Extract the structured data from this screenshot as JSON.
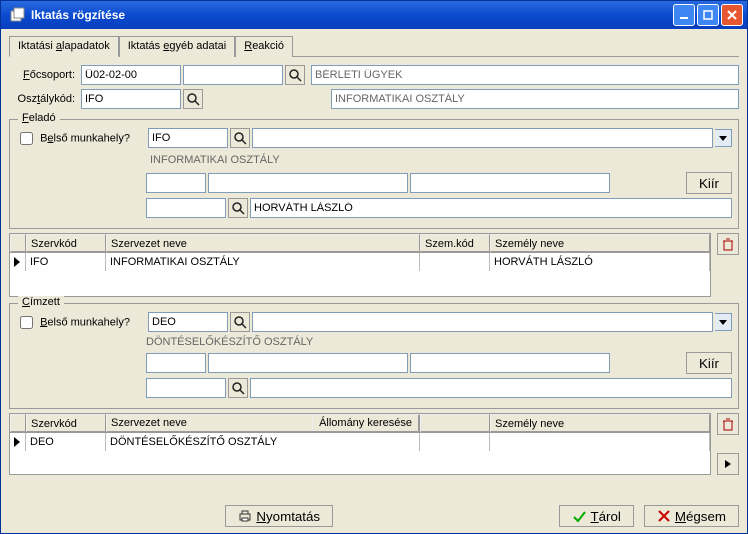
{
  "window": {
    "title": "Iktatás rögzítése"
  },
  "tabs": [
    {
      "label_pre": "Iktatási ",
      "label_u": "a",
      "label_post": "lapadatok"
    },
    {
      "label_pre": "Iktatás ",
      "label_u": "e",
      "label_post": "gyéb adatai"
    },
    {
      "label_pre": "",
      "label_u": "R",
      "label_post": "eakció"
    }
  ],
  "main": {
    "focsoport_label_pre": "",
    "focsoport_label_u": "F",
    "focsoport_label_post": "őcsoport:",
    "focsoport_value": "Ü02-02-00",
    "focsoport_name": "BÉRLETI ÜGYEK",
    "osztalykod_label_pre": "Osz",
    "osztalykod_label_u": "t",
    "osztalykod_label_post": "álykód:",
    "osztalykod_value": "IFO",
    "osztalykod_name": "INFORMATIKAI OSZTÁLY"
  },
  "felado": {
    "legend_u": "F",
    "legend_post": "eladó",
    "belso_label_pre": "B",
    "belso_label_u": "e",
    "belso_label_post": "lső munkahely?",
    "code": "IFO",
    "org_name": "INFORMATIKAI OSZTÁLY",
    "person_name": "HORVÁTH LÁSZLÓ",
    "kiir_label": "Kiír",
    "grid": {
      "headers": [
        "Szervkód",
        "Szervezet neve",
        "Szem.kód",
        "Személy neve"
      ],
      "rows": [
        {
          "szervkod": "IFO",
          "szervnev": "INFORMATIKAI OSZTÁLY",
          "szemkod": "",
          "szemnev": "HORVÁTH LÁSZLÓ"
        }
      ]
    }
  },
  "cimzett": {
    "legend_u": "C",
    "legend_post": "ímzett",
    "belso_label_pre": "",
    "belso_label_u": "B",
    "belso_label_post": "első munkahely?",
    "code": "DEO",
    "org_name": "DÖNTÉSELŐKÉSZÍTŐ OSZTÁLY",
    "kiir_label": "Kiír",
    "allomany_label": "Állomány keresése",
    "grid": {
      "headers": [
        "Szervkód",
        "Szervezet neve",
        "",
        "Személy neve"
      ],
      "rows": [
        {
          "szervkod": "DEO",
          "szervnev": "DÖNTÉSELŐKÉSZÍTŐ OSZTÁLY",
          "szemkod": "",
          "szemnev": ""
        }
      ]
    }
  },
  "footer": {
    "print_u": "N",
    "print_post": "yomtatás",
    "store_u": "T",
    "store_post": "árol",
    "cancel_u": "M",
    "cancel_post": "égsem"
  }
}
